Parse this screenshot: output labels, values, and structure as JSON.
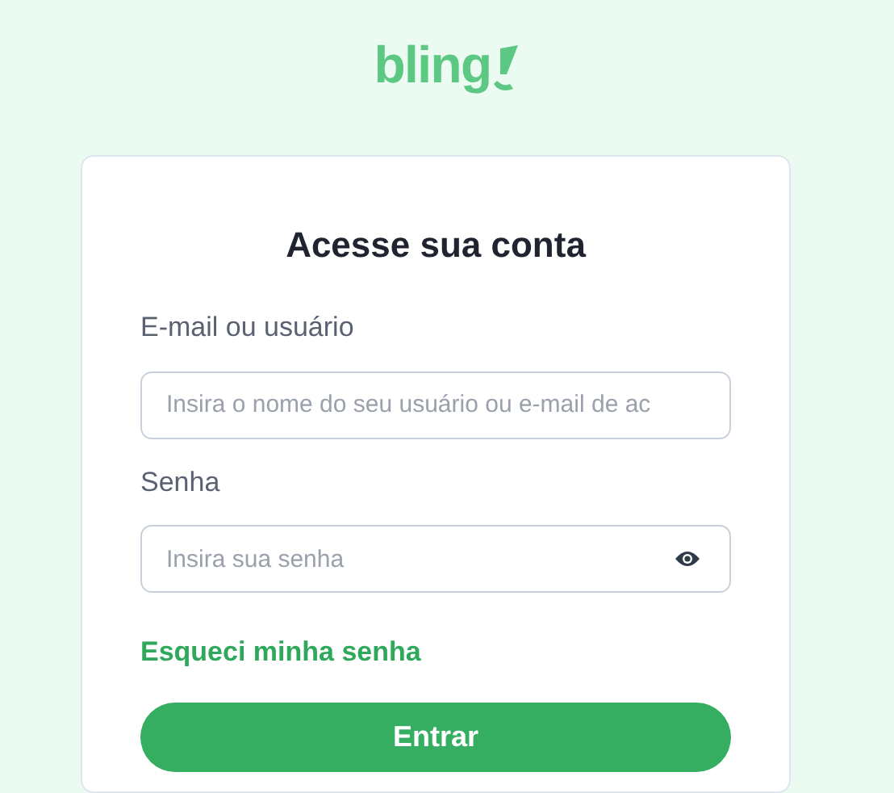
{
  "logo": {
    "text": "bling"
  },
  "title": "Acesse sua conta",
  "fields": [
    {
      "kind": "text",
      "label": "E-mail ou usuário",
      "placeholder": "Insira o nome do seu usuário ou e-mail de ac"
    },
    {
      "kind": "password",
      "label": "Senha",
      "placeholder": "Insira sua senha"
    }
  ],
  "forgot_link": "Esqueci minha senha",
  "submit_button": "Entrar"
}
